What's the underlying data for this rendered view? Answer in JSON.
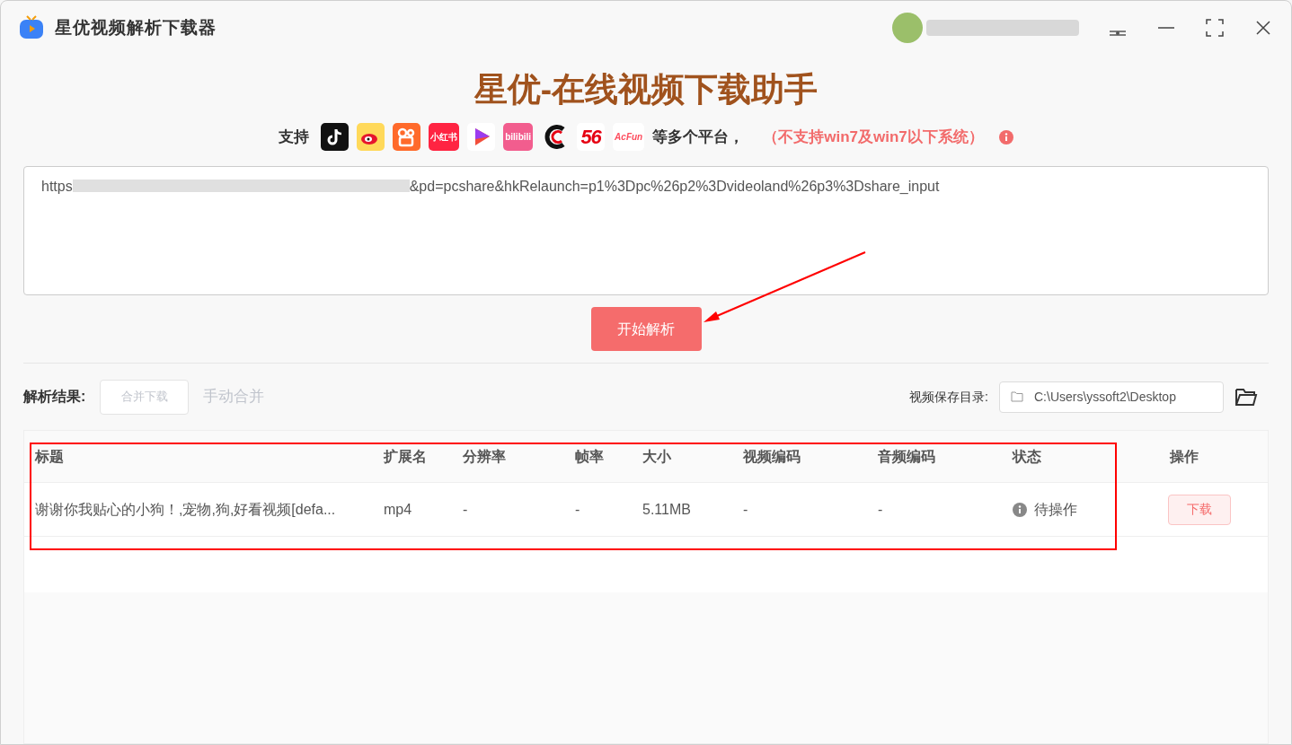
{
  "window": {
    "title": "星优视频解析下载器"
  },
  "heading": "星优-在线视频下载助手",
  "support": {
    "prefix": "支持",
    "suffix": "等多个平台，",
    "note": "（不支持win7及win7以下系统）",
    "platforms": [
      {
        "kind": "tiktok"
      },
      {
        "kind": "weibo"
      },
      {
        "kind": "kuaishou"
      },
      {
        "kind": "badge",
        "label": "小红书",
        "color": "#ff2442"
      },
      {
        "kind": "play"
      },
      {
        "kind": "badge",
        "label": "bilibili",
        "color": "#f25d8e"
      },
      {
        "kind": "cc"
      },
      {
        "kind": "text",
        "label": "56",
        "color": "#e60012"
      },
      {
        "kind": "text",
        "label": "AcFun",
        "color": "#fd4c5d"
      }
    ]
  },
  "url_input": {
    "visible_start": "https",
    "visible_end": "&pd=pcshare&hkRelaunch=p1%3Dpc%26p2%3Dvideoland%26p3%3Dshare_input"
  },
  "parse_button": "开始解析",
  "results": {
    "label": "解析结果:",
    "merge_download": {
      "label": "合并下载",
      "disabled": true
    },
    "manual_merge": {
      "label": "手动合并",
      "disabled": true
    },
    "save_dir_label": "视频保存目录:",
    "save_dir": "C:\\Users\\yssoft2\\Desktop"
  },
  "table": {
    "columns": [
      "标题",
      "扩展名",
      "分辨率",
      "帧率",
      "大小",
      "视频编码",
      "音频编码",
      "状态",
      "操作"
    ],
    "rows": [
      {
        "cells": [
          "谢谢你我贴心的小狗！,宠物,狗,好看视频[defa...",
          "mp4",
          "-",
          "-",
          "5.11MB",
          "-",
          "-"
        ],
        "status": "待操作",
        "action": "下载"
      }
    ]
  }
}
